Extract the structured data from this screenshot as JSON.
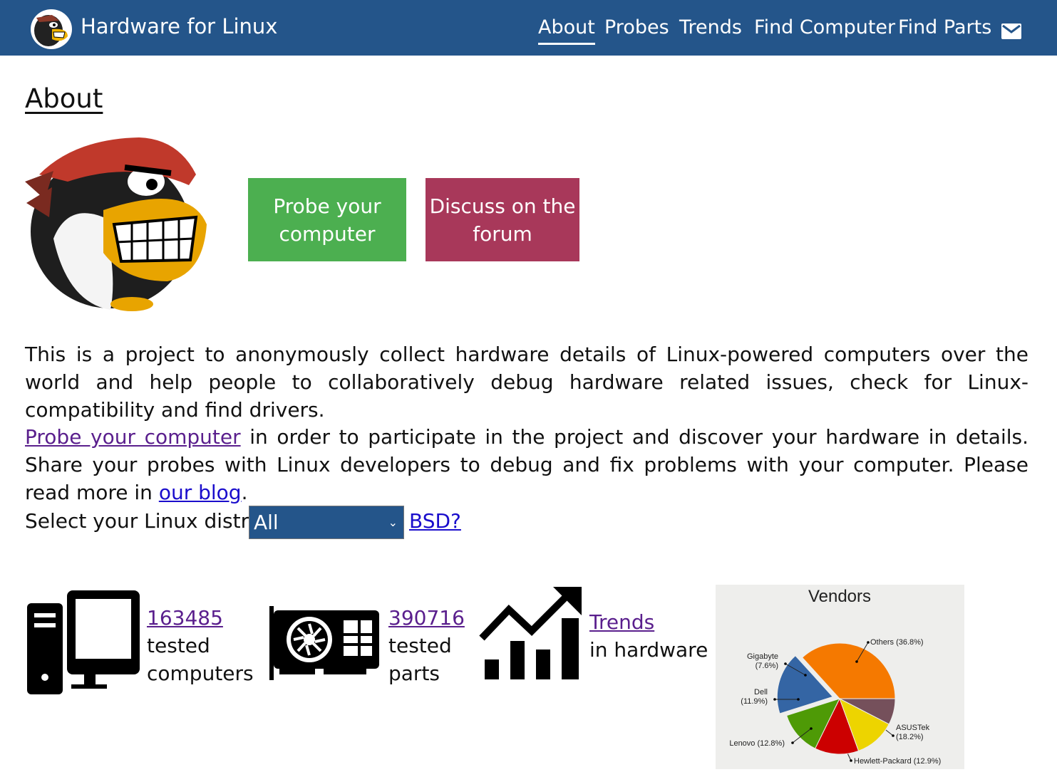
{
  "header": {
    "site_title": "Hardware for Linux",
    "nav": [
      {
        "label": "About",
        "active": true
      },
      {
        "label": "Probes",
        "active": false
      },
      {
        "label": "Trends",
        "active": false
      },
      {
        "label": "Find Computer",
        "active": false
      },
      {
        "label": "Find Parts",
        "active": false
      }
    ],
    "mail_icon": "mail-icon",
    "bar_color": "#24558a"
  },
  "main": {
    "page_title": "About",
    "buttons": {
      "probe": "Probe your computer",
      "forum": "Discuss on the forum"
    },
    "intro": "This is a project to anonymously collect hardware details of Linux-powered computers over the world and help people to collaboratively debug hardware related issues, check for Linux-compatibility and find drivers.",
    "cta": {
      "link": "Probe your computer",
      "text": " in order to participate in the project and discover your hardware in details. Share your probes with Linux developers to debug and fix problems with your computer. Please read more in ",
      "blog_link": "our blog",
      "end": "."
    },
    "distro": {
      "label": "Select your Linux distro:",
      "selected": "All",
      "bsd_link": "BSD?"
    },
    "stats": {
      "computers": {
        "count": "163485",
        "line1": "tested",
        "line2": "computers"
      },
      "parts": {
        "count": "390716",
        "line1": "tested",
        "line2": "parts"
      },
      "trends": {
        "link": "Trends",
        "text": "in hardware"
      }
    }
  },
  "colors": {
    "probe_button": "#4caf50",
    "forum_button": "#a8385a",
    "visited_link": "#5a1f8d",
    "link": "#1a0dcc"
  },
  "chart_data": {
    "type": "pie",
    "title": "Vendors",
    "slices": [
      {
        "label": "Others (36.8%)",
        "value": 36.8,
        "color": "#f57900"
      },
      {
        "label": "ASUSTek (18.2%)",
        "value": 18.2,
        "color": "#3465a4",
        "exploded": true
      },
      {
        "label": "Hewlett-Packard (12.9%)",
        "value": 12.9,
        "color": "#4e9a06"
      },
      {
        "label": "Lenovo (12.8%)",
        "value": 12.8,
        "color": "#cc0000"
      },
      {
        "label": "Dell (11.9%)",
        "value": 11.9,
        "color": "#edd400"
      },
      {
        "label": "Gigabyte (7.6%)",
        "value": 7.6,
        "color": "#75505b"
      }
    ]
  }
}
